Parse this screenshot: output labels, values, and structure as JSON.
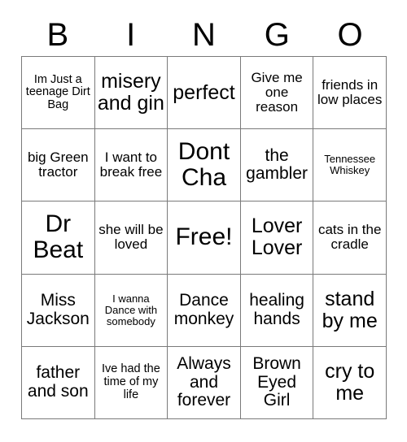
{
  "card": {
    "title": "BINGO",
    "header_letters": [
      "B",
      "I",
      "N",
      "G",
      "O"
    ],
    "rows": 5,
    "columns": 5,
    "free_space": "Free!",
    "border_color": "#7a7a7a",
    "background_color": "#ffffff",
    "text_color": "#000000"
  },
  "cells": [
    {
      "text": "Im Just a teenage Dirt Bag",
      "column": "B",
      "row": 1,
      "size": "xs",
      "free": false
    },
    {
      "text": "misery and gin",
      "column": "I",
      "row": 1,
      "size": "lg",
      "free": false
    },
    {
      "text": "perfect",
      "column": "N",
      "row": 1,
      "size": "lg",
      "free": false
    },
    {
      "text": "Give me one reason",
      "column": "G",
      "row": 1,
      "size": "sm",
      "free": false
    },
    {
      "text": "friends in low places",
      "column": "O",
      "row": 1,
      "size": "sm",
      "free": false
    },
    {
      "text": "big Green tractor",
      "column": "B",
      "row": 2,
      "size": "sm",
      "free": false
    },
    {
      "text": "I want to break free",
      "column": "I",
      "row": 2,
      "size": "sm",
      "free": false
    },
    {
      "text": "Dont Cha",
      "column": "N",
      "row": 2,
      "size": "xl",
      "free": false
    },
    {
      "text": "the gambler",
      "column": "G",
      "row": 2,
      "size": "md",
      "free": false
    },
    {
      "text": "Tennessee Whiskey",
      "column": "O",
      "row": 2,
      "size": "xxs",
      "free": false
    },
    {
      "text": "Dr Beat",
      "column": "B",
      "row": 3,
      "size": "xl",
      "free": false
    },
    {
      "text": "she will be loved",
      "column": "I",
      "row": 3,
      "size": "sm",
      "free": false
    },
    {
      "text": "Free!",
      "column": "N",
      "row": 3,
      "size": "xl",
      "free": true
    },
    {
      "text": "Lover Lover",
      "column": "G",
      "row": 3,
      "size": "lg",
      "free": false
    },
    {
      "text": "cats in the cradle",
      "column": "O",
      "row": 3,
      "size": "sm",
      "free": false
    },
    {
      "text": "Miss Jackson",
      "column": "B",
      "row": 4,
      "size": "md",
      "free": false
    },
    {
      "text": "I wanna Dance with somebody",
      "column": "I",
      "row": 4,
      "size": "xxs",
      "free": false
    },
    {
      "text": "Dance monkey",
      "column": "N",
      "row": 4,
      "size": "md",
      "free": false
    },
    {
      "text": "healing hands",
      "column": "G",
      "row": 4,
      "size": "md",
      "free": false
    },
    {
      "text": "stand by me",
      "column": "O",
      "row": 4,
      "size": "lg",
      "free": false
    },
    {
      "text": "father and son",
      "column": "B",
      "row": 5,
      "size": "md",
      "free": false
    },
    {
      "text": "Ive had the time of my life",
      "column": "I",
      "row": 5,
      "size": "xs",
      "free": false
    },
    {
      "text": "Always and forever",
      "column": "N",
      "row": 5,
      "size": "md",
      "free": false
    },
    {
      "text": "Brown Eyed Girl",
      "column": "G",
      "row": 5,
      "size": "md",
      "free": false
    },
    {
      "text": "cry to me",
      "column": "O",
      "row": 5,
      "size": "lg",
      "free": false
    }
  ]
}
